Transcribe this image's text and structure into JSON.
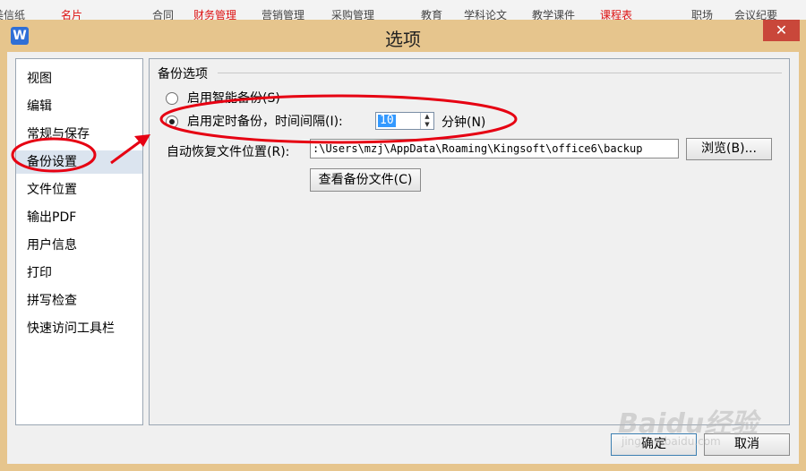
{
  "background_tabs": [
    {
      "label": "美信纸",
      "color": "#444444"
    },
    {
      "label": "名片",
      "color": "#dd1111"
    },
    {
      "label": "合同",
      "color": "#444444"
    },
    {
      "label": "财务管理",
      "color": "#dd1111"
    },
    {
      "label": "营销管理",
      "color": "#444444"
    },
    {
      "label": "采购管理",
      "color": "#444444"
    },
    {
      "label": "教育",
      "color": "#444444"
    },
    {
      "label": "学科论文",
      "color": "#444444"
    },
    {
      "label": "教学课件",
      "color": "#444444"
    },
    {
      "label": "课程表",
      "color": "#dd1111"
    },
    {
      "label": "职场",
      "color": "#444444"
    },
    {
      "label": "会议纪要",
      "color": "#444444"
    }
  ],
  "dialog": {
    "title": "选项",
    "app_icon": "W",
    "close_symbol": "✕"
  },
  "nav": {
    "items": [
      {
        "label": "视图"
      },
      {
        "label": "编辑"
      },
      {
        "label": "常规与保存"
      },
      {
        "label": "备份设置",
        "selected": true
      },
      {
        "label": "文件位置"
      },
      {
        "label": "输出PDF"
      },
      {
        "label": "用户信息"
      },
      {
        "label": "打印"
      },
      {
        "label": "拼写检查"
      },
      {
        "label": "快速访问工具栏"
      }
    ]
  },
  "backup": {
    "group_title": "备份选项",
    "smart_backup_label": "启用智能备份(S)",
    "smart_backup_checked": false,
    "timed_backup_label": "启用定时备份，时间间隔(I):",
    "timed_backup_checked": true,
    "interval_value": "10",
    "interval_unit": "分钟(N)",
    "recover_path_label": "自动恢复文件位置(R):",
    "recover_path_value": ":\\Users\\mzj\\AppData\\Roaming\\Kingsoft\\office6\\backup",
    "browse_label": "浏览(B)...",
    "view_backup_label": "查看备份文件(C)"
  },
  "footer": {
    "ok_label": "确定",
    "cancel_label": "取消"
  },
  "watermark": {
    "brand": "Baidu经验",
    "url": "jingyan.baidu.com"
  },
  "colors": {
    "frame": "#e6c58d",
    "close": "#c9473a",
    "annotation": "#e60012",
    "selection": "#3399ff"
  }
}
